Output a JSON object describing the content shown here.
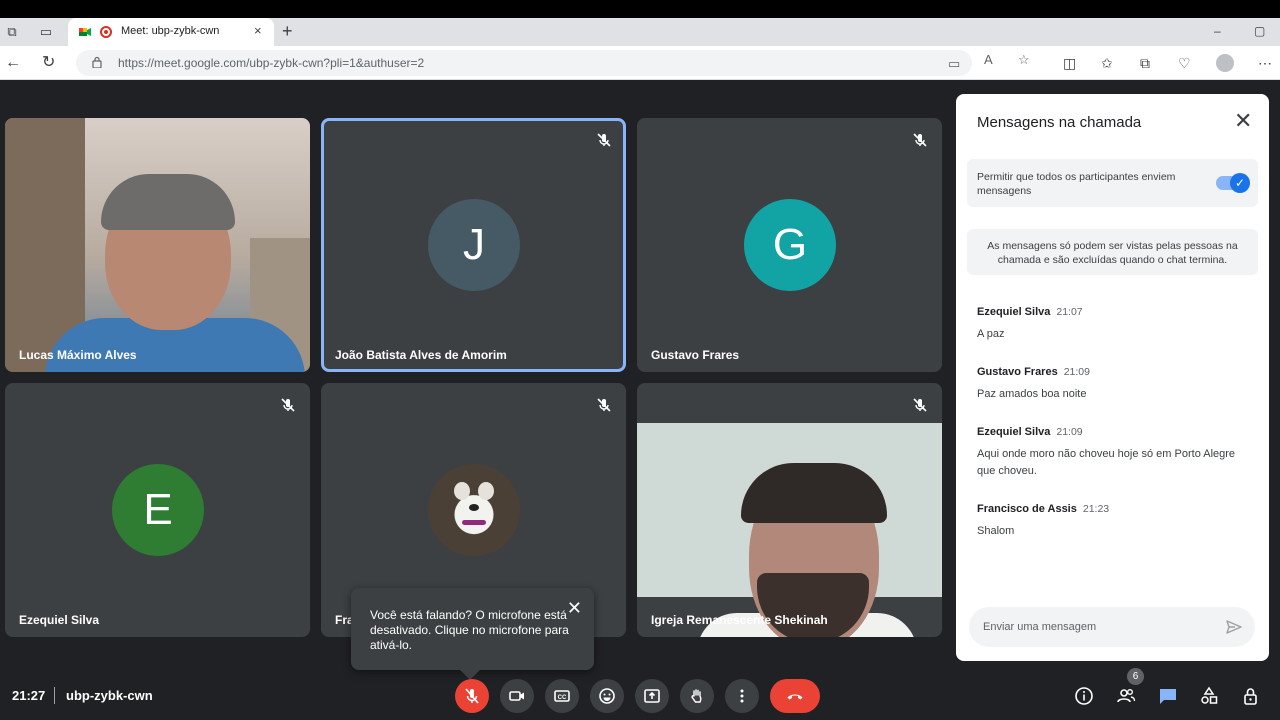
{
  "browser": {
    "tab_title": "Meet: ubp-zybk-cwn",
    "tab_close": "×",
    "new_tab": "+",
    "url": "https://meet.google.com/ubp-zybk-cwn?pli=1&authuser=2",
    "window_controls": [
      "–",
      "▢"
    ],
    "toolbar_icons": [
      "camera-icon",
      "read-aloud-icon",
      "favorite-icon",
      "split-screen-icon",
      "favorites-icon",
      "collections-icon",
      "browser-essentials-icon",
      "profile-icon",
      "more-icon"
    ]
  },
  "tiles": [
    {
      "name": "Lucas Máximo Alves",
      "type": "video",
      "muted": false
    },
    {
      "name": "João Batista Alves de Amorim",
      "type": "avatar",
      "initial": "J",
      "color": "#455a64",
      "muted": true,
      "active": true
    },
    {
      "name": "Gustavo Frares",
      "type": "avatar",
      "initial": "G",
      "color": "#12a4a4",
      "muted": true
    },
    {
      "name": "Ezequiel Silva",
      "type": "avatar",
      "initial": "E",
      "color": "#2e7d32",
      "muted": true
    },
    {
      "name": "Fra",
      "type": "photo",
      "muted": true
    },
    {
      "name": "Igreja Remanescente Shekinah",
      "type": "video",
      "muted": true
    }
  ],
  "tooltip": {
    "text": "Você está falando? O microfone está desativado. Clique no microfone para ativá-lo.",
    "close": "✕"
  },
  "bottom": {
    "time": "21:27",
    "meeting_code": "ubp-zybk-cwn",
    "people_count": "6",
    "controls": [
      "mic-off-icon",
      "camera-icon",
      "captions-icon",
      "emoji-icon",
      "present-icon",
      "raise-hand-icon",
      "more-options-icon",
      "end-call-icon"
    ],
    "right_icons": [
      "info-icon",
      "people-icon",
      "chat-icon",
      "activities-icon",
      "host-controls-icon"
    ]
  },
  "chat": {
    "title": "Mensagens na chamada",
    "permit_text": "Permitir que todos os participantes enviem mensagens",
    "permit_enabled": true,
    "info_text": "As mensagens só podem ser vistas pelas pessoas na chamada e são excluídas quando o chat termina.",
    "messages": [
      {
        "sender": "Ezequiel Silva",
        "time": "21:07",
        "text": "A paz"
      },
      {
        "sender": "Gustavo Frares",
        "time": "21:09",
        "text": "Paz amados boa noite"
      },
      {
        "sender": "Ezequiel Silva",
        "time": "21:09",
        "text": "Aqui onde moro não choveu hoje só em Porto Alegre que choveu."
      },
      {
        "sender": "Francisco de Assis",
        "time": "21:23",
        "text": "Shalom"
      }
    ],
    "input_placeholder": "Enviar uma mensagem"
  },
  "colors": {
    "background": "#202124",
    "tile": "#3c4043",
    "active_border": "#8ab4f8",
    "end_call": "#ea4335",
    "accent": "#1a73e8",
    "chat_icon": "#8ab4f8"
  }
}
